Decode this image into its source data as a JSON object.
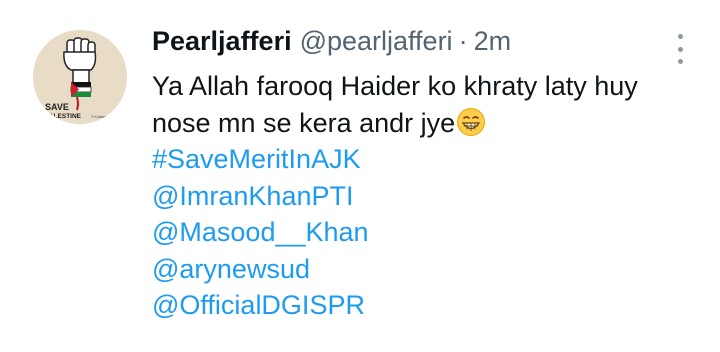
{
  "tweet": {
    "display_name": "Pearljafferi",
    "handle": "@pearljafferi",
    "separator": "·",
    "time": "2m",
    "text_lines": [
      "Ya Allah farooq Haider ko khraty laty huy",
      "nose mn se kera andr jye"
    ],
    "emoji": "grinning-face-with-teeth",
    "hashtag": "#SaveMeritInAJK",
    "mentions": [
      "@ImranKhanPTI",
      "@Masood__Khan",
      "@arynewsud",
      "@OfficialDGISPR"
    ],
    "avatar_text": {
      "line1": "SAVE",
      "line2": "PALESTINE",
      "small": "© Kuttabah"
    }
  },
  "colors": {
    "link": "#1d9bf0",
    "text": "#0f1419",
    "muted": "#536471",
    "avatar_bg": "#e9dcc6"
  }
}
